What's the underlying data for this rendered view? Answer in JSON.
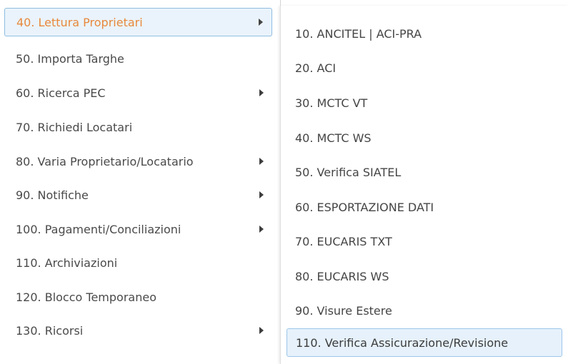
{
  "main_menu": {
    "items": [
      {
        "label": "40. Lettura Proprietari",
        "has_submenu": true,
        "active": true
      },
      {
        "label": "50. Importa Targhe",
        "has_submenu": false,
        "active": false
      },
      {
        "label": "60. Ricerca PEC",
        "has_submenu": true,
        "active": false
      },
      {
        "label": "70. Richiedi Locatari",
        "has_submenu": false,
        "active": false
      },
      {
        "label": "80. Varia Proprietario/Locatario",
        "has_submenu": true,
        "active": false
      },
      {
        "label": "90. Notifiche",
        "has_submenu": true,
        "active": false
      },
      {
        "label": "100. Pagamenti/Conciliazioni",
        "has_submenu": true,
        "active": false
      },
      {
        "label": "110. Archiviazioni",
        "has_submenu": false,
        "active": false
      },
      {
        "label": "120. Blocco Temporaneo",
        "has_submenu": false,
        "active": false
      },
      {
        "label": "130. Ricorsi",
        "has_submenu": true,
        "active": false
      }
    ]
  },
  "sub_menu": {
    "items": [
      {
        "label": "10. ANCITEL | ACI-PRA",
        "active": false
      },
      {
        "label": "20. ACI",
        "active": false
      },
      {
        "label": "30. MCTC VT",
        "active": false
      },
      {
        "label": "40. MCTC WS",
        "active": false
      },
      {
        "label": "50. Verifica SIATEL",
        "active": false
      },
      {
        "label": "60. ESPORTAZIONE DATI",
        "active": false
      },
      {
        "label": "70. EUCARIS TXT",
        "active": false
      },
      {
        "label": "80. EUCARIS WS",
        "active": false
      },
      {
        "label": "90. Visure Estere",
        "active": false
      },
      {
        "label": "110. Verifica Assicurazione/Revisione",
        "active": true
      }
    ]
  },
  "colors": {
    "active_text": "#e8893c",
    "active_background": "#eaf3fb",
    "active_border": "#8fbde2",
    "text": "#4a4a4a"
  }
}
